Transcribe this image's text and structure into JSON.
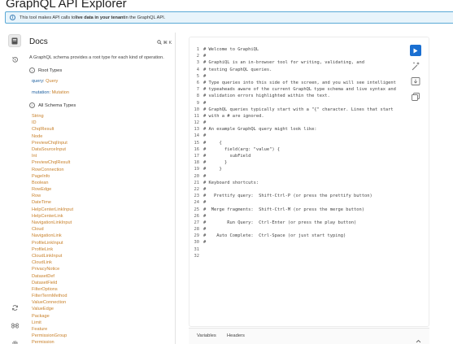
{
  "page_title": "GraphQL API Explorer",
  "banner": {
    "prefix": "This tool makes API calls to ",
    "bold": "live data in your tenant",
    "suffix": " in the GraphQL API."
  },
  "docs": {
    "title": "Docs",
    "search_hint": "⌘ K",
    "description": "A GraphQL schema provides a root type for each kind of operation.",
    "root_types_heading": "Root Types",
    "root_types": [
      {
        "field": "query",
        "type": "Query"
      },
      {
        "field": "mutation",
        "type": "Mutation"
      }
    ],
    "all_types_heading": "All Schema Types",
    "types": [
      "String",
      "ID",
      "ChqlResult",
      "Node",
      "PreviewChqlInput",
      "DataSourceInput",
      "Int",
      "PreviewChqlResult",
      "RowConnection",
      "PageInfo",
      "Boolean",
      "RowEdge",
      "Row",
      "DateTime",
      "HelpCenterLinkInput",
      "HelpCenterLink",
      "NavigationLinkInput",
      "Cloud",
      "NavigationLink",
      "ProfileLinkInput",
      "ProfileLink",
      "CloudLinkInput",
      "CloudLink",
      "PrivacyNotice",
      "DatasetDef",
      "DatasetField",
      "FilterOptions",
      "FilterTermMethod",
      "ValueConnection",
      "ValueEdge",
      "Package",
      "Limit",
      "Feature",
      "PermissionGroup",
      "Permission"
    ]
  },
  "editor": {
    "lines": [
      "# Welcome to GraphiQL",
      "#",
      "# GraphiQL is an in-browser tool for writing, validating, and",
      "# testing GraphQL queries.",
      "#",
      "# Type queries into this side of the screen, and you will see intelligent",
      "# typeaheads aware of the current GraphQL type schema and live syntax and",
      "# validation errors highlighted within the text.",
      "#",
      "# GraphQL queries typically start with a \"{\" character. Lines that start",
      "# with a # are ignored.",
      "#",
      "# An example GraphQL query might look like:",
      "#",
      "#     {",
      "#       field(arg: \"value\") {",
      "#         subField",
      "#       }",
      "#     }",
      "#",
      "# Keyboard shortcuts:",
      "#",
      "#   Prettify query:  Shift-Ctrl-P (or press the prettify button)",
      "#",
      "#  Merge fragments:  Shift-Ctrl-M (or press the merge button)",
      "#",
      "#        Run Query:  Ctrl-Enter (or press the play button)",
      "#",
      "#    Auto Complete:  Ctrl-Space (or just start typing)",
      "#",
      "",
      ""
    ]
  },
  "bottom_tabs": [
    "Variables",
    "Headers"
  ],
  "colors": {
    "accent": "#1a6fd1",
    "type": "#c8802a",
    "field": "#1f61a0",
    "banner_bg": "#e8f4fb",
    "banner_border": "#5aa9d6"
  }
}
